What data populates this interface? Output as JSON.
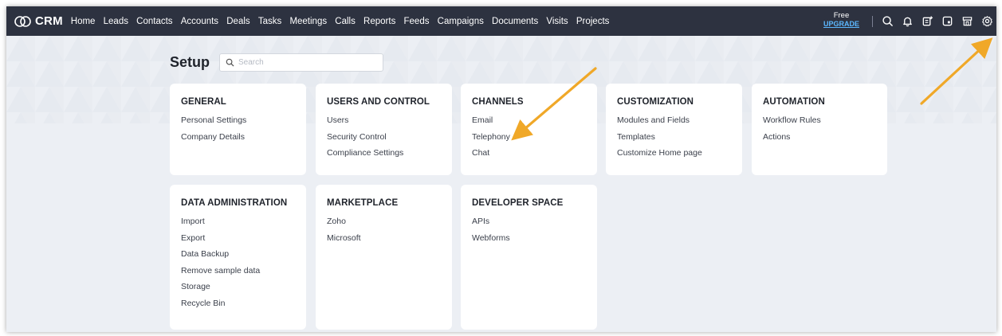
{
  "brand": {
    "name": "CRM",
    "logo_icon": "crm-logo-icon"
  },
  "nav": [
    "Home",
    "Leads",
    "Contacts",
    "Accounts",
    "Deals",
    "Tasks",
    "Meetings",
    "Calls",
    "Reports",
    "Feeds",
    "Campaigns",
    "Documents",
    "Visits",
    "Projects"
  ],
  "plan": {
    "label": "Free",
    "upgrade": "UPGRADE"
  },
  "toolbar_icons": [
    "search-icon",
    "bell-icon",
    "add-note-icon",
    "calendar-icon",
    "marketplace-icon",
    "settings-icon"
  ],
  "setup": {
    "title": "Setup",
    "search_placeholder": "Search"
  },
  "colors": {
    "topbar": "#2d3240",
    "upgrade_link": "#5cb8ff",
    "page_bg": "#eceff4",
    "annotation_arrow": "#f0a828"
  },
  "sections": [
    {
      "title": "GENERAL",
      "items": [
        "Personal Settings",
        "Company Details"
      ]
    },
    {
      "title": "USERS AND CONTROL",
      "items": [
        "Users",
        "Security Control",
        "Compliance Settings"
      ]
    },
    {
      "title": "CHANNELS",
      "items": [
        "Email",
        "Telephony",
        "Chat"
      ]
    },
    {
      "title": "CUSTOMIZATION",
      "items": [
        "Modules and Fields",
        "Templates",
        "Customize Home page"
      ]
    },
    {
      "title": "AUTOMATION",
      "items": [
        "Workflow Rules",
        "Actions"
      ]
    },
    {
      "title": "DATA ADMINISTRATION",
      "items": [
        "Import",
        "Export",
        "Data Backup",
        "Remove sample data",
        "Storage",
        "Recycle Bin"
      ]
    },
    {
      "title": "MARKETPLACE",
      "items": [
        "Zoho",
        "Microsoft"
      ]
    },
    {
      "title": "DEVELOPER SPACE",
      "items": [
        "APIs",
        "Webforms"
      ]
    }
  ]
}
